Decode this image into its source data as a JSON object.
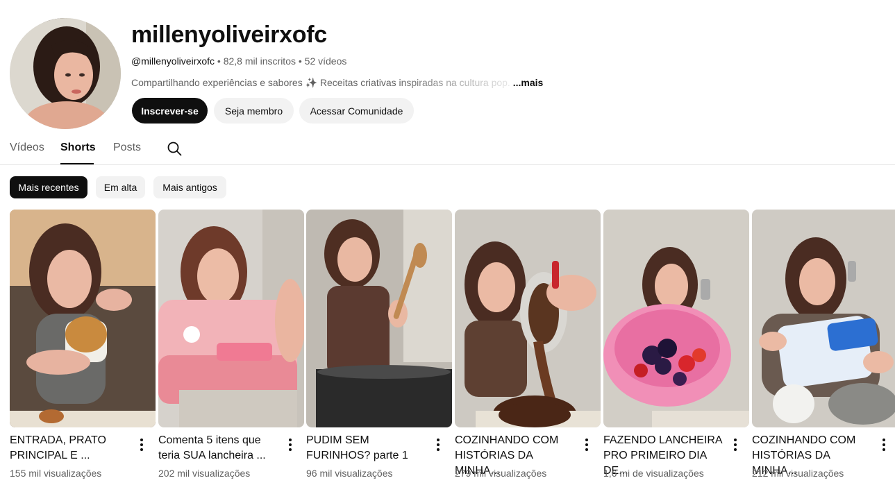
{
  "channel": {
    "name": "millenyoliveirxofc",
    "handle": "@millenyoliveirxofc",
    "separator1": " • ",
    "subscribers": "82,8 mil inscritos",
    "separator2": " • ",
    "video_count": "52 vídeos",
    "description": "Compartilhando experiências e sabores ✨ Receitas criativas inspiradas na cultura pop.",
    "description_more": "...mais"
  },
  "actions": {
    "subscribe": "Inscrever-se",
    "join": "Seja membro",
    "community": "Acessar Comunidade"
  },
  "tabs": [
    {
      "label": "Vídeos",
      "active": false
    },
    {
      "label": "Shorts",
      "active": true
    },
    {
      "label": "Posts",
      "active": false
    }
  ],
  "filters": [
    {
      "label": "Mais recentes",
      "active": true
    },
    {
      "label": "Em alta",
      "active": false
    },
    {
      "label": "Mais antigos",
      "active": false
    }
  ],
  "shorts": [
    {
      "title": "ENTRADA, PRATO PRINCIPAL E ...",
      "views": "155 mil visualizações"
    },
    {
      "title": "Comenta 5 itens que teria SUA lancheira ...",
      "views": "202 mil visualizações"
    },
    {
      "title": "PUDIM SEM FURINHOS? parte 1",
      "views": "96 mil visualizações"
    },
    {
      "title": "COZINHANDO COM HISTÓRIAS DA MINHA...",
      "views": "279 mil visualizações"
    },
    {
      "title": "FAZENDO LANCHEIRA PRO PRIMEIRO DIA DE...",
      "views": "1,6 mi de visualizações"
    },
    {
      "title": "COZINHANDO COM HISTÓRIAS DA MINHA...",
      "views": "212 mil visualizações"
    }
  ],
  "icons": {
    "search": "search-icon",
    "more": "more-vert-icon"
  }
}
